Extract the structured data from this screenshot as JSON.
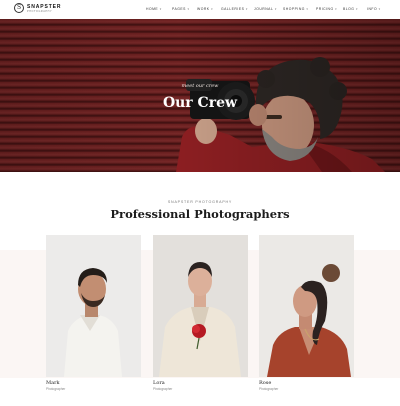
{
  "header": {
    "logo_mark": "S",
    "logo_title": "SNAPSTER",
    "logo_subtitle": "PHOTOGRAPHY",
    "nav": [
      "HOME",
      "PAGES",
      "WORK",
      "GALLERIES",
      "JOURNAL",
      "SHOPPING",
      "PRICING",
      "BLOG",
      "INFO"
    ]
  },
  "hero": {
    "tagline": "meet our crew",
    "title": "Our Crew"
  },
  "section": {
    "eyebrow": "SNAPSTER PHOTOGRAPHY",
    "title": "Professional Photographers"
  },
  "team": [
    {
      "name": "Mark",
      "role": "Photographer"
    },
    {
      "name": "Lora",
      "role": "Photographer"
    },
    {
      "name": "Rose",
      "role": "Photographer"
    }
  ],
  "colors": {
    "hero_background": "#6a1f1f",
    "band_background": "#fbf6f4",
    "photo_background": "#ecebea"
  }
}
